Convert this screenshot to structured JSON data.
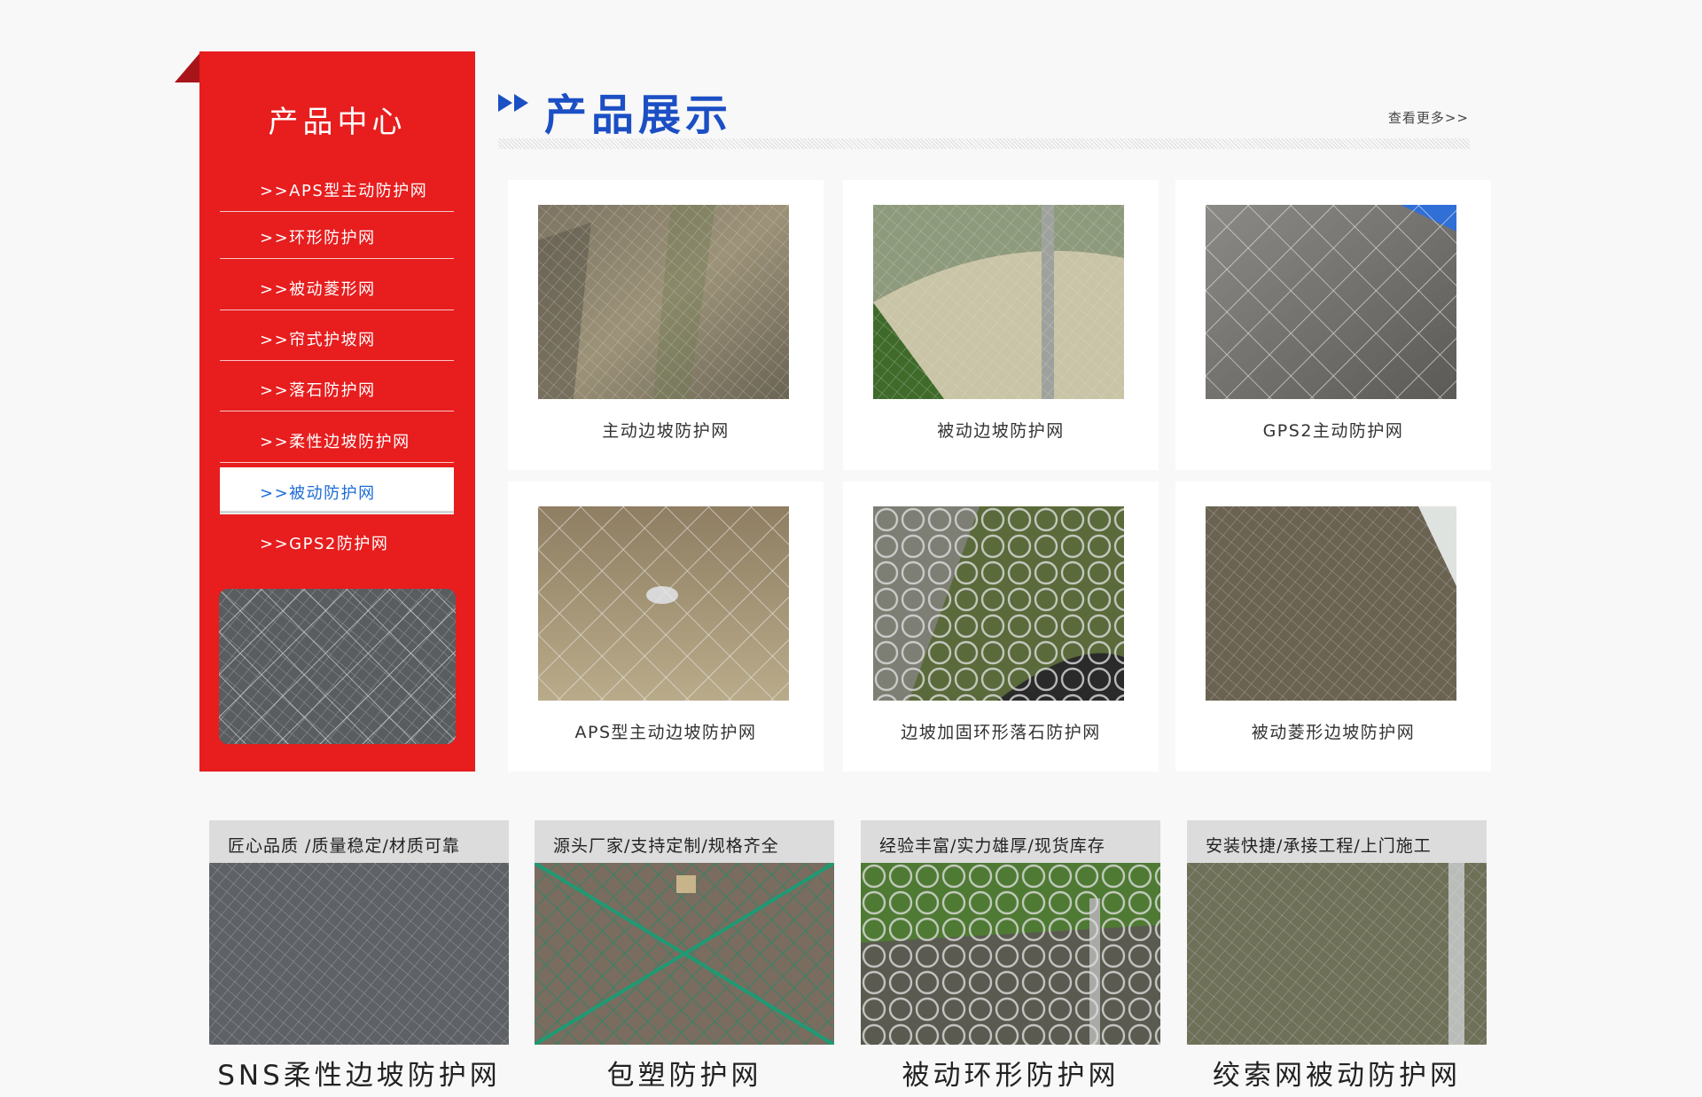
{
  "sidebar": {
    "title": "产品中心",
    "items": [
      {
        "label": ">>APS型主动防护网",
        "active": false
      },
      {
        "label": ">>环形防护网",
        "active": false
      },
      {
        "label": ">>被动菱形网",
        "active": false
      },
      {
        "label": ">>帘式护坡网",
        "active": false
      },
      {
        "label": ">>落石防护网",
        "active": false
      },
      {
        "label": ">>柔性边坡防护网",
        "active": false
      },
      {
        "label": ">>被动防护网",
        "active": true
      },
      {
        "label": ">>GPS2防护网",
        "active": false
      }
    ],
    "accent_color": "#e71d1e"
  },
  "heading": {
    "title": "产品展示",
    "more": "查看更多>>",
    "title_color": "#1c4fc4"
  },
  "products": [
    {
      "caption": "主动边坡防护网"
    },
    {
      "caption": "被动边坡防护网"
    },
    {
      "caption": "GPS2主动防护网"
    },
    {
      "caption": "APS型主动边坡防护网"
    },
    {
      "caption": "边坡加固环形落石防护网"
    },
    {
      "caption": "被动菱形边坡防护网"
    }
  ],
  "features": [
    {
      "tagline": "匠心品质 /质量稳定/材质可靠",
      "title": "SNS柔性边坡防护网"
    },
    {
      "tagline": "源头厂家/支持定制/规格齐全",
      "title": "包塑防护网"
    },
    {
      "tagline": "经验丰富/实力雄厚/现货库存",
      "title": "被动环形防护网"
    },
    {
      "tagline": "安装快捷/承接工程/上门施工",
      "title": "绞索网被动防护网"
    }
  ]
}
